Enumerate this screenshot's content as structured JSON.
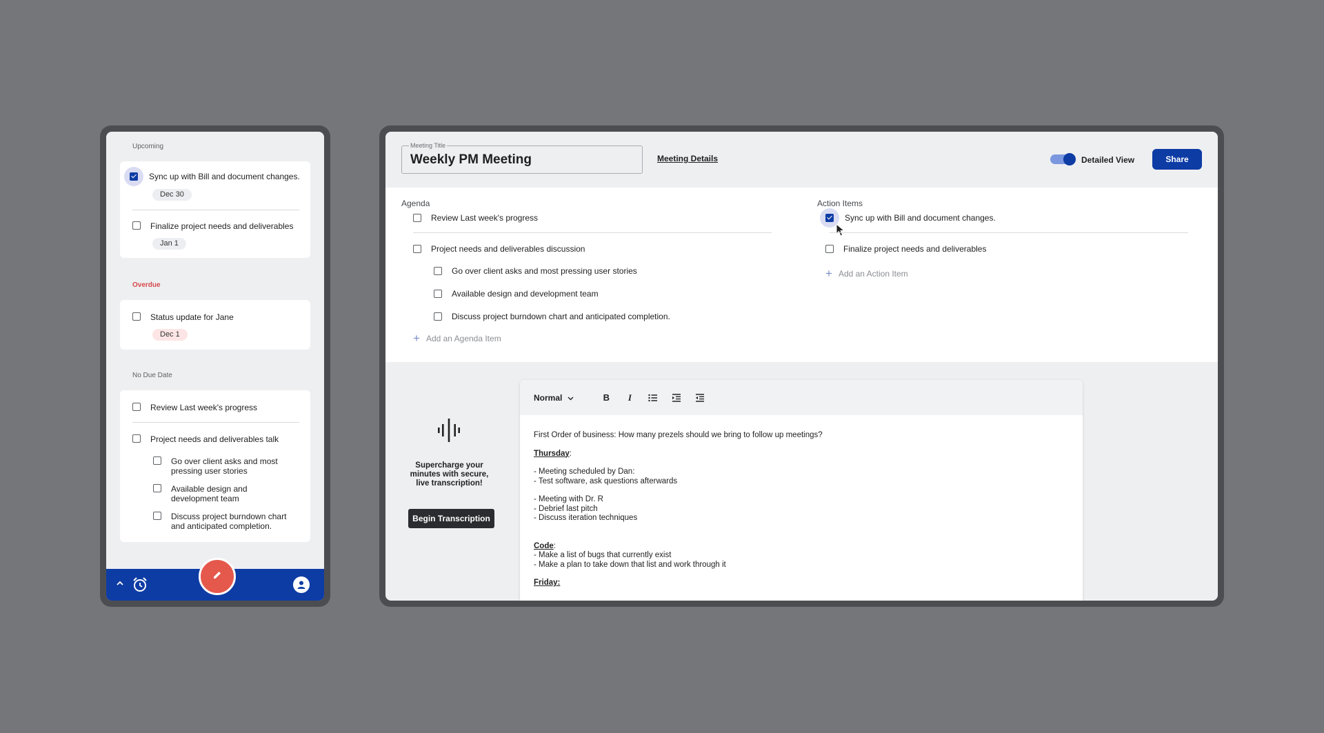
{
  "mobile": {
    "sections": {
      "upcoming": "Upcoming",
      "overdue": "Overdue",
      "no_due_date": "No Due Date"
    },
    "upcoming_items": [
      {
        "label": "Sync up with Bill and document changes.",
        "date": "Dec 30",
        "checked": true
      },
      {
        "label": "Finalize project needs and deliverables",
        "date": "Jan 1",
        "checked": false
      }
    ],
    "overdue_items": [
      {
        "label": "Status update for Jane",
        "date": "Dec 1",
        "checked": false
      }
    ],
    "no_due_items": [
      {
        "label": "Review Last week's progress"
      },
      {
        "label": "Project needs and deliverables talk"
      }
    ],
    "sub_items": [
      {
        "label": "Go over client asks and most pressing user stories"
      },
      {
        "label": "Available design and development team"
      },
      {
        "label": "Discuss project burndown chart and anticipated completion."
      }
    ],
    "icons": [
      "chevron-up-icon",
      "alarm-icon",
      "edit-icon",
      "account-icon"
    ]
  },
  "meeting": {
    "title_legend": "Meeting Title",
    "title": "Weekly PM Meeting",
    "details_link": "Meeting Details",
    "detailed_view_label": "Detailed View",
    "detailed_view_on": true,
    "share_label": "Share"
  },
  "agenda": {
    "heading": "Agenda",
    "items": [
      {
        "label": "Review Last week's progress"
      },
      {
        "label": "Project needs and deliverables discussion"
      }
    ],
    "sub_items": [
      {
        "label": "Go over client asks and most pressing user stories"
      },
      {
        "label": "Available design and development team"
      },
      {
        "label": "Discuss project burndown chart and anticipated completion."
      }
    ],
    "add_label": "Add an Agenda Item"
  },
  "action_items": {
    "heading": "Action Items",
    "items": [
      {
        "label": "Sync up with Bill and document changes.",
        "checked": true
      },
      {
        "label": "Finalize project needs and deliverables",
        "checked": false
      }
    ],
    "add_label": "Add an Action Item"
  },
  "transcription": {
    "promo": "Supercharge your minutes with secure, live transcription!",
    "button": "Begin Transcription"
  },
  "editor": {
    "style_select": "Normal",
    "toolbar": [
      "bold-icon",
      "italic-icon",
      "bulleted-list-icon",
      "indent-icon",
      "outdent-icon"
    ],
    "lines": {
      "l1": "First Order of business: How many prezels should we bring to follow up meetings?",
      "thursday": "Thursday",
      "l2": "- Meeting scheduled by Dan:",
      "l3": "- Test software, ask questions afterwards",
      "l4": "- Meeting with Dr. R",
      "l5": "- Debrief last pitch",
      "l6": "- Discuss iteration techniques",
      "code": "Code",
      "l7": "- Make a list of bugs that currently exist",
      "l8": "- Make a plan to take down that list and work through it",
      "friday": "Friday:"
    }
  },
  "colors": {
    "primary": "#0e3ca5",
    "fab": "#e5584c",
    "overdue": "#d6484a",
    "background": "#757679"
  }
}
